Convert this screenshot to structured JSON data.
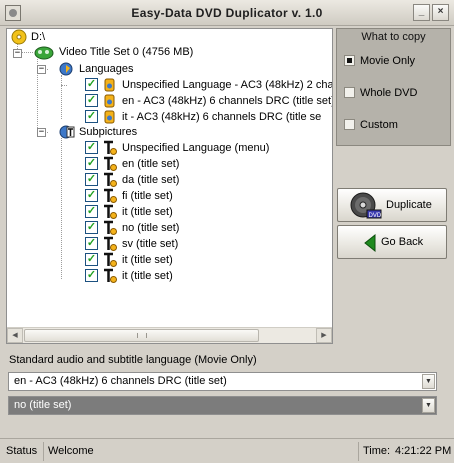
{
  "window": {
    "title": "Easy-Data DVD Duplicator v. 1.0",
    "minimize_glyph": "_",
    "close_glyph": "×"
  },
  "tree": {
    "root": {
      "label": "D:\\",
      "icon": "cd-disc-icon"
    },
    "title_set": {
      "label": "Video Title Set 0 (4756 MB)",
      "icon": "film-reel-icon",
      "expander": "−"
    },
    "languages": {
      "label": "Languages",
      "icon": "audio-language-icon",
      "expander": "−",
      "items": [
        {
          "label": "Unspecified Language - AC3 (48kHz) 2 cha",
          "checked": true
        },
        {
          "label": "en - AC3 (48kHz) 6 channels DRC (title set)",
          "checked": true
        },
        {
          "label": "it - AC3 (48kHz) 6 channels DRC (title se",
          "checked": true
        }
      ]
    },
    "subpictures": {
      "label": "Subpictures",
      "icon": "subtitle-icon",
      "expander": "−",
      "items": [
        {
          "label": "Unspecified Language (menu)",
          "checked": true
        },
        {
          "label": "en (title set)",
          "checked": true
        },
        {
          "label": "da (title set)",
          "checked": true
        },
        {
          "label": "fi (title set)",
          "checked": true
        },
        {
          "label": "it (title set)",
          "checked": true
        },
        {
          "label": "no (title set)",
          "checked": true
        },
        {
          "label": "sv (title set)",
          "checked": true
        },
        {
          "label": "it (title set)",
          "checked": true
        },
        {
          "label": "it (title set)",
          "checked": true
        }
      ]
    },
    "checkmark": "✓"
  },
  "copy_options": {
    "title": "What to copy",
    "options": [
      {
        "label": "Movie Only",
        "selected": true
      },
      {
        "label": "Whole DVD",
        "selected": false
      },
      {
        "label": "Custom",
        "selected": false
      }
    ]
  },
  "buttons": {
    "duplicate": {
      "label": "Duplicate",
      "icon": "dvd-disc-icon"
    },
    "go_back": {
      "label": "Go Back",
      "icon": "back-arrow-icon"
    }
  },
  "defaults": {
    "section_label": "Standard audio and subtitle language (Movie Only)",
    "audio_value": "en - AC3 (48kHz) 6 channels DRC (title set)",
    "subtitle_value": "no (title set)"
  },
  "status": {
    "label": "Status",
    "message": "Welcome",
    "time_label": "Time:",
    "time_value": "4:21:22 PM"
  },
  "colors": {
    "check_green": "#21a121",
    "go_back_green": "#1e8a1e",
    "group_bg": "#b5b2aa"
  }
}
